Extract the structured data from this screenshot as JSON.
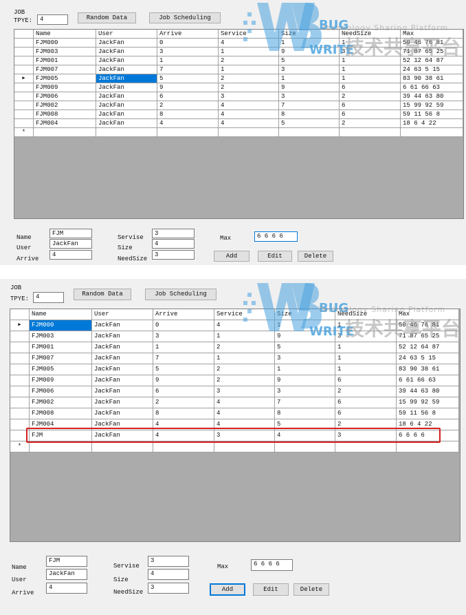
{
  "columns": [
    "Name",
    "User",
    "Arrive",
    "Service",
    "Size",
    "NeedSize",
    "Max"
  ],
  "labels": {
    "job": "JOB",
    "tpye": "TPYE:",
    "name": "Name",
    "user": "User",
    "arrive": "Arrive",
    "servise": "Servise",
    "size": "Size",
    "needsize": "NeedSize",
    "max": "Max"
  },
  "buttons": {
    "random": "Random Data",
    "schedule": "Job Scheduling",
    "add": "Add",
    "edit": "Edit",
    "delete": "Delete"
  },
  "marks": {
    "current": "▶",
    "new": "*"
  },
  "watermark": {
    "line1": "Technology Sharing Platform",
    "bug": "BUG",
    "write": "WRITE",
    "chinese": "技术共享平台"
  },
  "colors": {
    "selection": "#0078d7",
    "highlight": "#d41f1f",
    "logo": "#4aa3df"
  },
  "win1": {
    "type_value": "4",
    "selected_row": 4,
    "selected_col": 1,
    "rows": [
      [
        "FJM000",
        "JackFan",
        "0",
        "4",
        "1",
        "1",
        "50 46 76 81"
      ],
      [
        "FJM003",
        "JackFan",
        "3",
        "1",
        "9",
        "3",
        "71 87 65 25"
      ],
      [
        "FJM001",
        "JackFan",
        "1",
        "2",
        "5",
        "1",
        "52 12 64 87"
      ],
      [
        "FJM007",
        "JackFan",
        "7",
        "1",
        "3",
        "1",
        "24 63 5 15"
      ],
      [
        "FJM005",
        "JackFan",
        "5",
        "2",
        "1",
        "1",
        "83 90 38 61"
      ],
      [
        "FJM009",
        "JackFan",
        "9",
        "2",
        "9",
        "6",
        "6 61 66 63"
      ],
      [
        "FJM006",
        "JackFan",
        "6",
        "3",
        "3",
        "2",
        "39 44 63 80"
      ],
      [
        "FJM002",
        "JackFan",
        "2",
        "4",
        "7",
        "6",
        "15 99 92 59"
      ],
      [
        "FJM008",
        "JackFan",
        "8",
        "4",
        "8",
        "6",
        "59 11 56 8"
      ],
      [
        "FJM004",
        "JackFan",
        "4",
        "4",
        "5",
        "2",
        "18 6 4 22"
      ]
    ],
    "form": {
      "name": "FJM",
      "user": "JackFan",
      "arrive": "4",
      "servise": "3",
      "size": "4",
      "needsize": "3",
      "max": "6 6 6 6"
    }
  },
  "win2": {
    "type_value": "4",
    "selected_row": 0,
    "selected_col": 0,
    "highlight_row": 10,
    "rows": [
      [
        "FJM000",
        "JackFan",
        "0",
        "4",
        "1",
        "1",
        "50 46 76 81"
      ],
      [
        "FJM003",
        "JackFan",
        "3",
        "1",
        "9",
        "3",
        "71 87 65 25"
      ],
      [
        "FJM001",
        "JackFan",
        "1",
        "2",
        "5",
        "1",
        "52 12 64 87"
      ],
      [
        "FJM007",
        "JackFan",
        "7",
        "1",
        "3",
        "1",
        "24 63 5 15"
      ],
      [
        "FJM005",
        "JackFan",
        "5",
        "2",
        "1",
        "1",
        "83 90 38 61"
      ],
      [
        "FJM009",
        "JackFan",
        "9",
        "2",
        "9",
        "6",
        "6 61 66 63"
      ],
      [
        "FJM006",
        "JackFan",
        "6",
        "3",
        "3",
        "2",
        "39 44 63 80"
      ],
      [
        "FJM002",
        "JackFan",
        "2",
        "4",
        "7",
        "6",
        "15 99 92 59"
      ],
      [
        "FJM008",
        "JackFan",
        "8",
        "4",
        "8",
        "6",
        "59 11 56 8"
      ],
      [
        "FJM004",
        "JackFan",
        "4",
        "4",
        "5",
        "2",
        "18 6 4 22"
      ],
      [
        "FJM",
        "JackFan",
        "4",
        "3",
        "4",
        "3",
        "6 6 6 6"
      ]
    ],
    "form": {
      "name": "FJM",
      "user": "JackFan",
      "arrive": "4",
      "servise": "3",
      "size": "4",
      "needsize": "3",
      "max": "6 6 6 6"
    }
  }
}
